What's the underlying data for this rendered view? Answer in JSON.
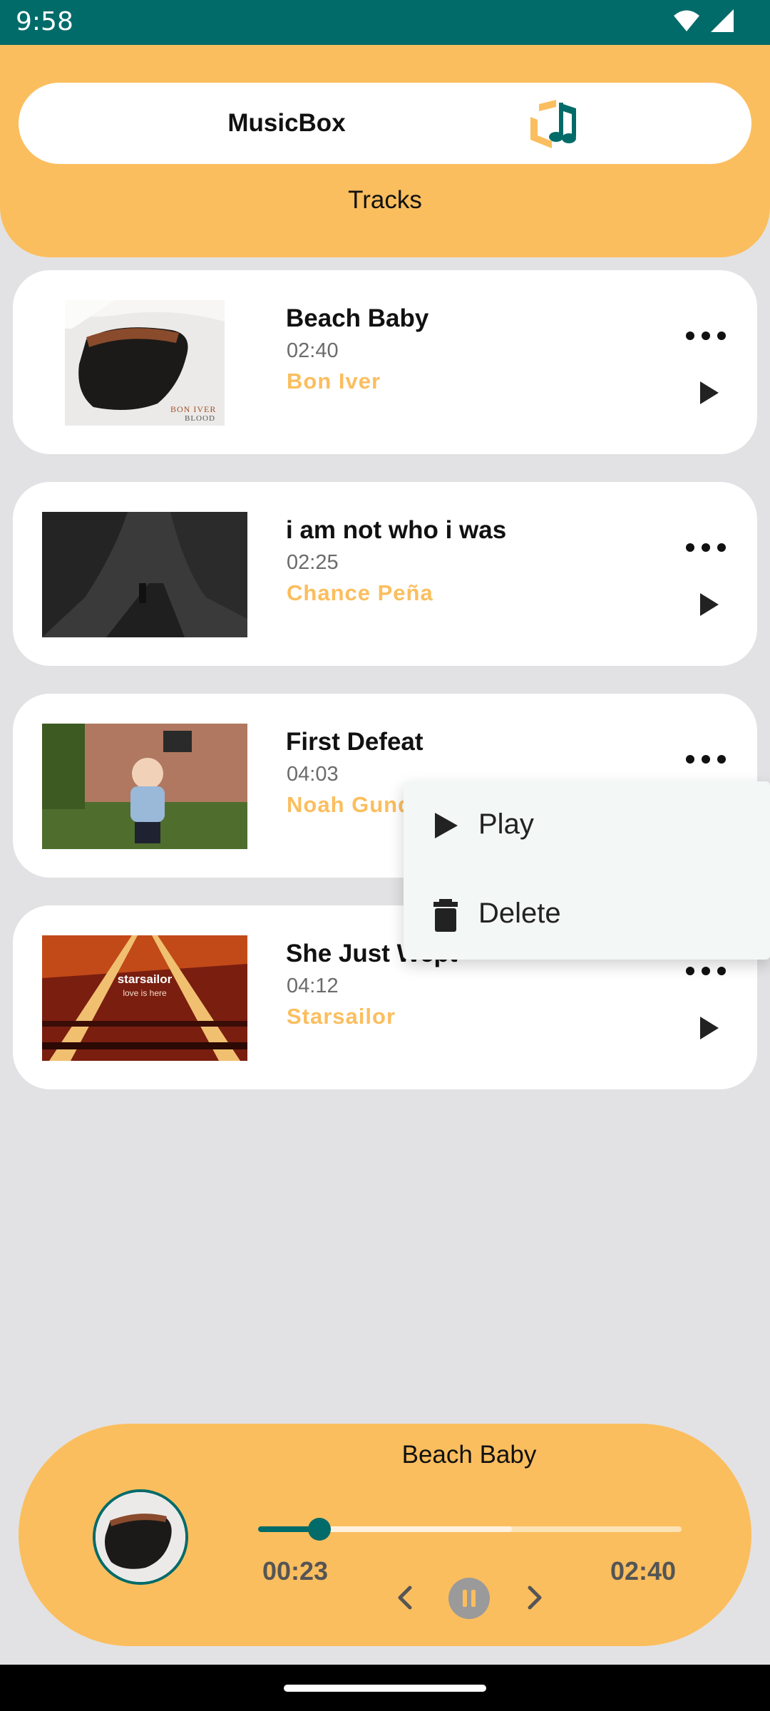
{
  "status_bar": {
    "time": "9:58",
    "wifi_icon": "wifi-icon",
    "signal_icon": "signal-icon"
  },
  "header": {
    "app_title": "MusicBox",
    "logo_icon": "music-note-logo",
    "section_title": "Tracks"
  },
  "tracks": [
    {
      "title": "Beach Baby",
      "duration": "02:40",
      "artist": "Bon Iver",
      "cover_caption": [
        "BON IVER",
        "BLOOD"
      ]
    },
    {
      "title": "i am not who i was",
      "duration": "02:25",
      "artist": "Chance Peña",
      "cover_caption": []
    },
    {
      "title": "First Defeat",
      "duration": "04:03",
      "artist": "Noah Gunderson",
      "cover_caption": []
    },
    {
      "title": "She Just Wept",
      "duration": "04:12",
      "artist": "Starsailor",
      "cover_caption": [
        "starsailor",
        "love is here"
      ]
    }
  ],
  "context_menu": {
    "items": [
      {
        "label": "Play",
        "icon": "play-icon"
      },
      {
        "label": "Delete",
        "icon": "trash-icon"
      }
    ]
  },
  "player": {
    "title": "Beach Baby",
    "current_time": "00:23",
    "total_time": "02:40",
    "progress": 0.144,
    "buffered": 0.6,
    "controls": [
      "previous-icon",
      "pause-icon",
      "next-icon"
    ]
  },
  "colors": {
    "accent": "#fbbe5e",
    "primary": "#016b69",
    "background": "#e2e2e4",
    "card": "#ffffff"
  }
}
